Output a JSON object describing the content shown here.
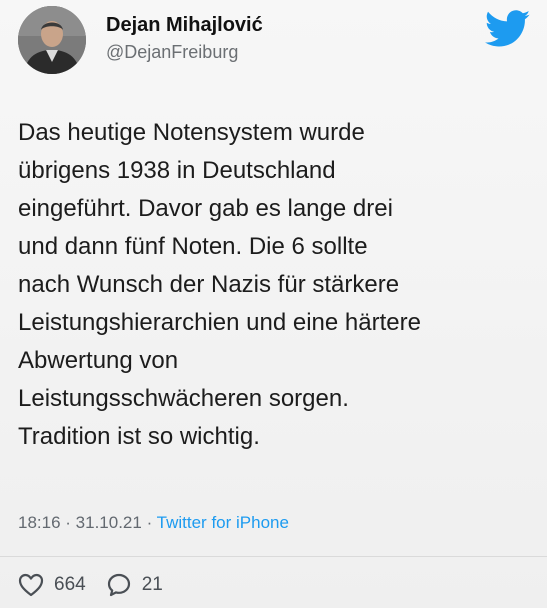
{
  "author": {
    "display_name": "Dejan Mihajlović",
    "handle": "@DejanFreiburg",
    "avatar": "profile-photo"
  },
  "brand": {
    "icon": "twitter-bird-icon",
    "color": "#1d9bf0"
  },
  "tweet": {
    "lines": [
      "Das heutige Notensystem wurde",
      "übrigens 1938 in Deutschland",
      "eingeführt. Davor gab es lange drei",
      "und dann fünf Noten. Die 6 sollte",
      "nach Wunsch der Nazis für stärkere",
      "Leistungshierarchien und eine härtere",
      "Abwertung von",
      "Leistungsschwächeren sorgen.",
      "Tradition ist so wichtig."
    ]
  },
  "meta": {
    "time": "18:16",
    "separator": " · ",
    "date": "31.10.21",
    "source": "Twitter for iPhone"
  },
  "actions": {
    "likes": {
      "icon": "heart-icon",
      "count": "664"
    },
    "replies": {
      "icon": "reply-bubble-icon",
      "count": "21"
    }
  },
  "colors": {
    "text": "#1c1c1c",
    "muted": "#636970",
    "link": "#1d9bf0"
  }
}
